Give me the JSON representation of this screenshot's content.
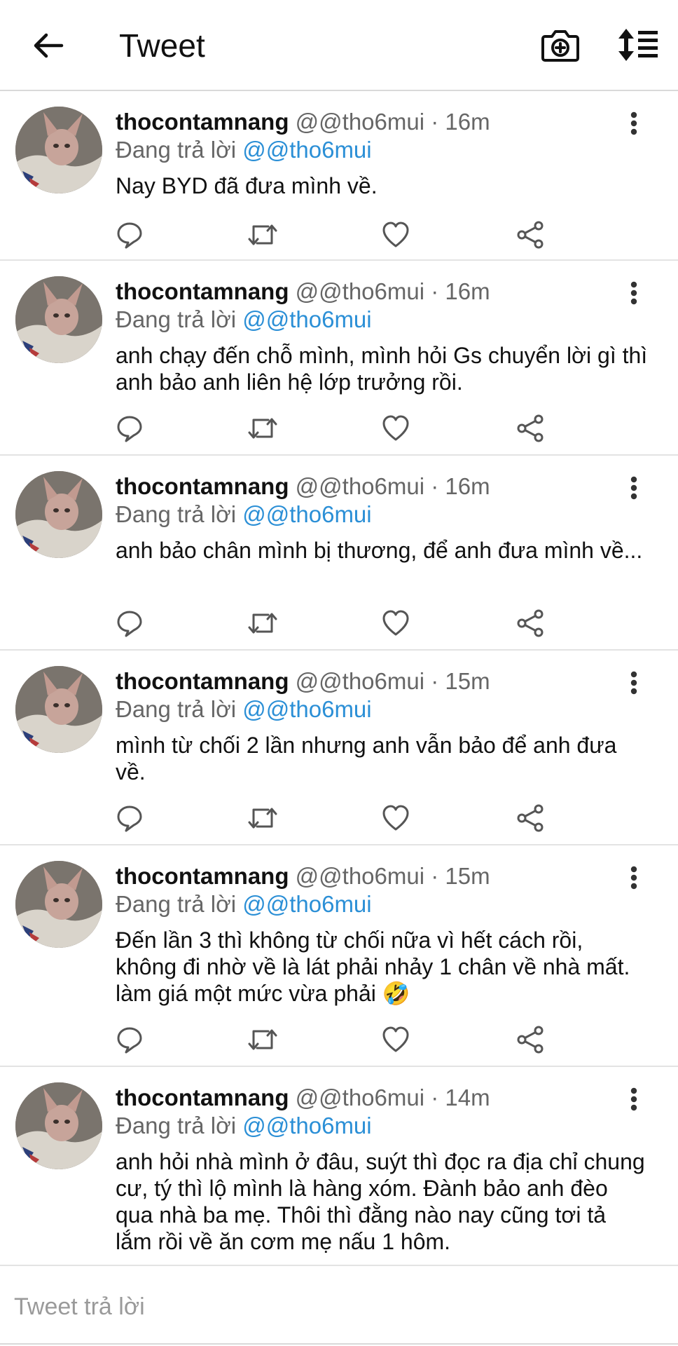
{
  "header": {
    "title": "Tweet"
  },
  "tweets": [
    {
      "name": "thocontamnang",
      "handle": "@@tho6mui",
      "sep": "·",
      "time": "16m",
      "reply_prefix": "Đang trả lời",
      "reply_to": "@@tho6mui",
      "text": "Nay BYD đã đưa mình về."
    },
    {
      "name": "thocontamnang",
      "handle": "@@tho6mui",
      "sep": "·",
      "time": "16m",
      "reply_prefix": "Đang trả lời",
      "reply_to": "@@tho6mui",
      "text": "anh chạy đến chỗ mình, mình hỏi Gs chuyển lời gì thì anh bảo anh liên hệ lớp trưởng rồi."
    },
    {
      "name": "thocontamnang",
      "handle": "@@tho6mui",
      "sep": "·",
      "time": "16m",
      "reply_prefix": "Đang trả lời",
      "reply_to": "@@tho6mui",
      "text": "anh bảo chân mình bị thương, để anh đưa mình về..."
    },
    {
      "name": "thocontamnang",
      "handle": "@@tho6mui",
      "sep": "·",
      "time": "15m",
      "reply_prefix": "Đang trả lời",
      "reply_to": "@@tho6mui",
      "text": "mình từ chối 2 lần nhưng anh vẫn bảo để anh đưa về."
    },
    {
      "name": "thocontamnang",
      "handle": "@@tho6mui",
      "sep": "·",
      "time": "15m",
      "reply_prefix": "Đang trả lời",
      "reply_to": "@@tho6mui",
      "text": "Đến lần 3 thì không từ chối nữa vì hết cách rồi, không đi nhờ về là lát phải nhảy 1 chân về nhà mất. làm giá một mức vừa phải 🤣"
    },
    {
      "name": "thocontamnang",
      "handle": "@@tho6mui",
      "sep": "·",
      "time": "14m",
      "reply_prefix": "Đang trả lời",
      "reply_to": "@@tho6mui",
      "text": "anh hỏi nhà mình ở đâu, suýt thì đọc ra địa chỉ chung cư, tý thì lộ mình là hàng xóm. Đành bảo anh đèo qua nhà ba mẹ. Thôi thì đằng nào nay cũng tơi tả lắm rồi về ăn cơm mẹ nấu 1 hôm."
    }
  ],
  "composer": {
    "placeholder": "Tweet trả lời"
  },
  "icons": {
    "back": "arrow-left-icon",
    "camera": "camera-plus-icon",
    "sort": "sort-list-icon",
    "more": "more-vertical-icon",
    "reply": "reply-icon",
    "retweet": "retweet-icon",
    "like": "heart-icon",
    "share": "share-icon"
  },
  "colors": {
    "link": "#2b8fd6",
    "secondary_text": "#666666",
    "divider": "#e3e3e3"
  }
}
